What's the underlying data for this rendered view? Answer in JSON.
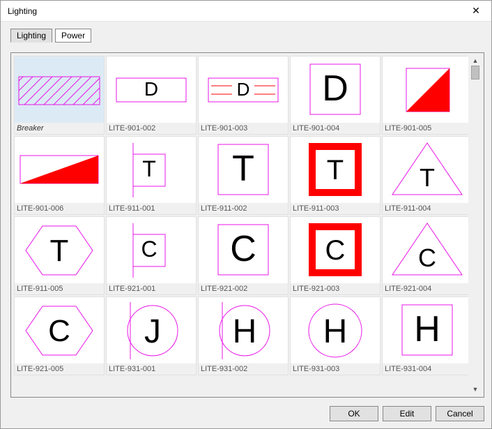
{
  "window": {
    "title": "Lighting"
  },
  "tabs": {
    "items": [
      "Lighting",
      "Power"
    ],
    "active_index": 0
  },
  "buttons": {
    "ok": "OK",
    "edit": "Edit",
    "cancel": "Cancel"
  },
  "colors": {
    "magenta": "#e815e8",
    "red": "#ff0000",
    "selection_bg": "#dceaf5",
    "button_bg": "#e1e1e1",
    "border": "#888888"
  },
  "gallery": {
    "selected_index": 0,
    "items": [
      {
        "label": "Breaker",
        "icon": "breaker"
      },
      {
        "label": "LITE-901-002",
        "icon": "rect-letter",
        "letter": "D",
        "rect_w": 100,
        "rect_h": 34
      },
      {
        "label": "LITE-901-003",
        "icon": "rect-letter-lines",
        "letter": "D"
      },
      {
        "label": "LITE-901-004",
        "icon": "square-letter",
        "letter": "D"
      },
      {
        "label": "LITE-901-005",
        "icon": "split-upper"
      },
      {
        "label": "LITE-901-006",
        "icon": "split-lower"
      },
      {
        "label": "LITE-911-001",
        "icon": "flag-square",
        "letter": "T"
      },
      {
        "label": "LITE-911-002",
        "icon": "square-letter",
        "letter": "T"
      },
      {
        "label": "LITE-911-003",
        "icon": "square-red-border",
        "letter": "T"
      },
      {
        "label": "LITE-911-004",
        "icon": "triangle-letter",
        "letter": "T"
      },
      {
        "label": "LITE-911-005",
        "icon": "hexagon-letter",
        "letter": "T"
      },
      {
        "label": "LITE-921-001",
        "icon": "flag-square",
        "letter": "C"
      },
      {
        "label": "LITE-921-002",
        "icon": "square-letter",
        "letter": "C"
      },
      {
        "label": "LITE-921-003",
        "icon": "square-red-border",
        "letter": "C"
      },
      {
        "label": "LITE-921-004",
        "icon": "triangle-letter",
        "letter": "C"
      },
      {
        "label": "LITE-921-005",
        "icon": "hexagon-letter",
        "letter": "C"
      },
      {
        "label": "LITE-931-001",
        "icon": "flag-circle",
        "letter": "J"
      },
      {
        "label": "LITE-931-002",
        "icon": "flag-circle",
        "letter": "H"
      },
      {
        "label": "LITE-931-003",
        "icon": "circle-letter",
        "letter": "H"
      },
      {
        "label": "LITE-931-004",
        "icon": "square-letter",
        "letter": "H"
      }
    ]
  }
}
